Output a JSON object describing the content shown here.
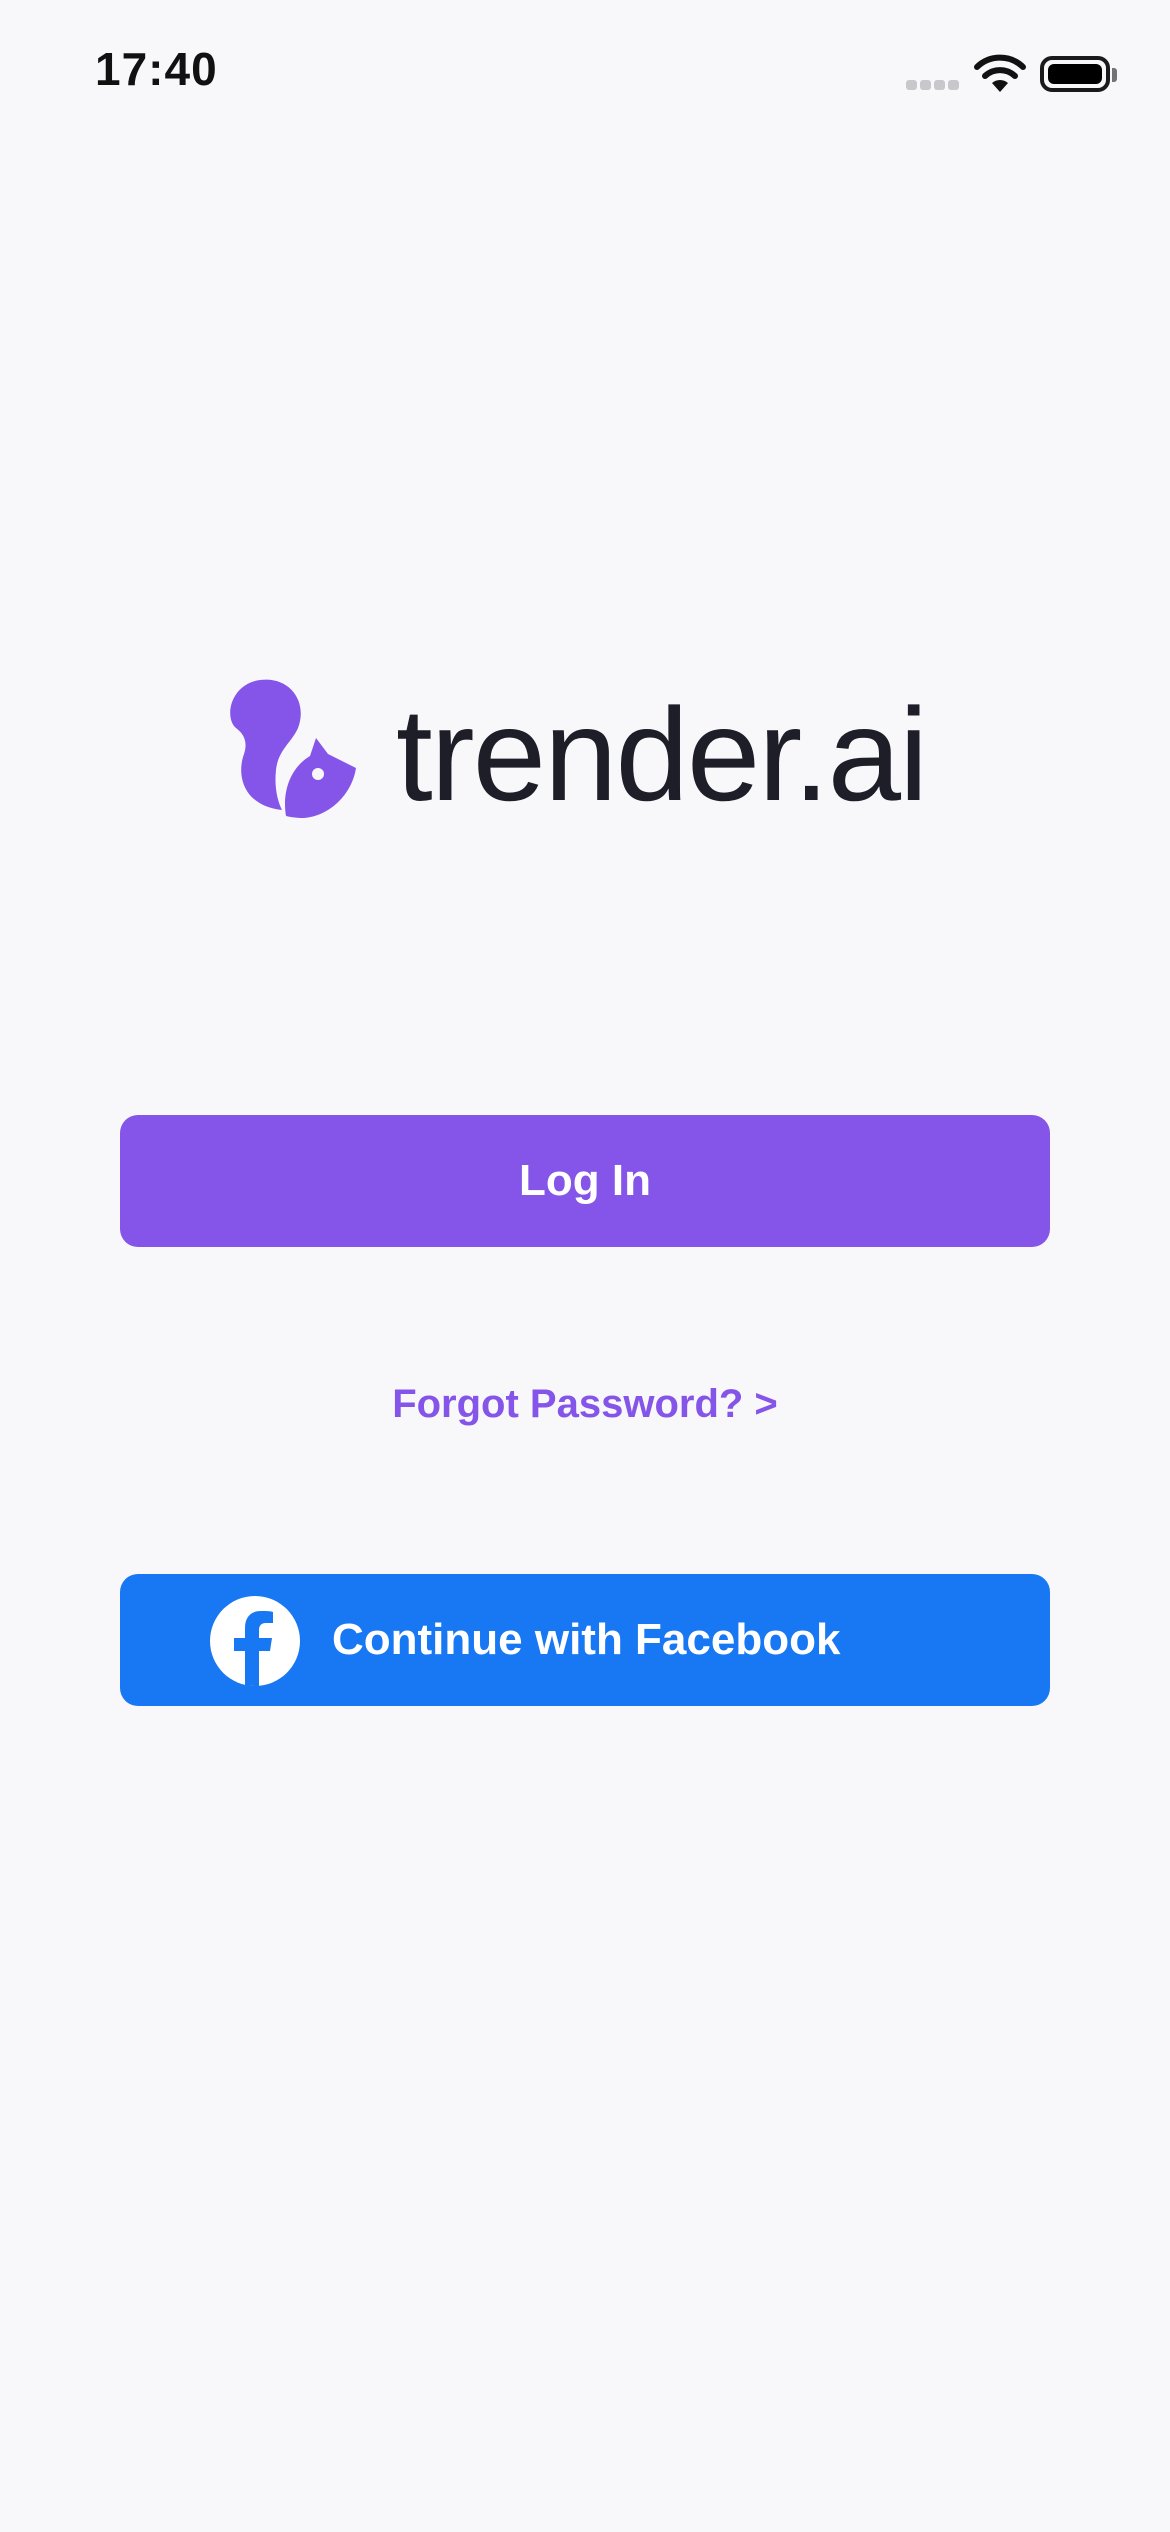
{
  "status_bar": {
    "time": "17:40",
    "signal_icon": "cellular-signal-icon",
    "wifi_icon": "wifi-icon",
    "battery_icon": "battery-icon"
  },
  "brand": {
    "name": "trender.ai",
    "logo_icon": "squirrel-logo-icon",
    "accent_color": "#8455E8"
  },
  "actions": {
    "login_label": "Log In",
    "forgot_password_label": "Forgot Password? >",
    "facebook_label": "Continue with Facebook",
    "facebook_icon": "facebook-icon",
    "facebook_color": "#1877F2"
  }
}
